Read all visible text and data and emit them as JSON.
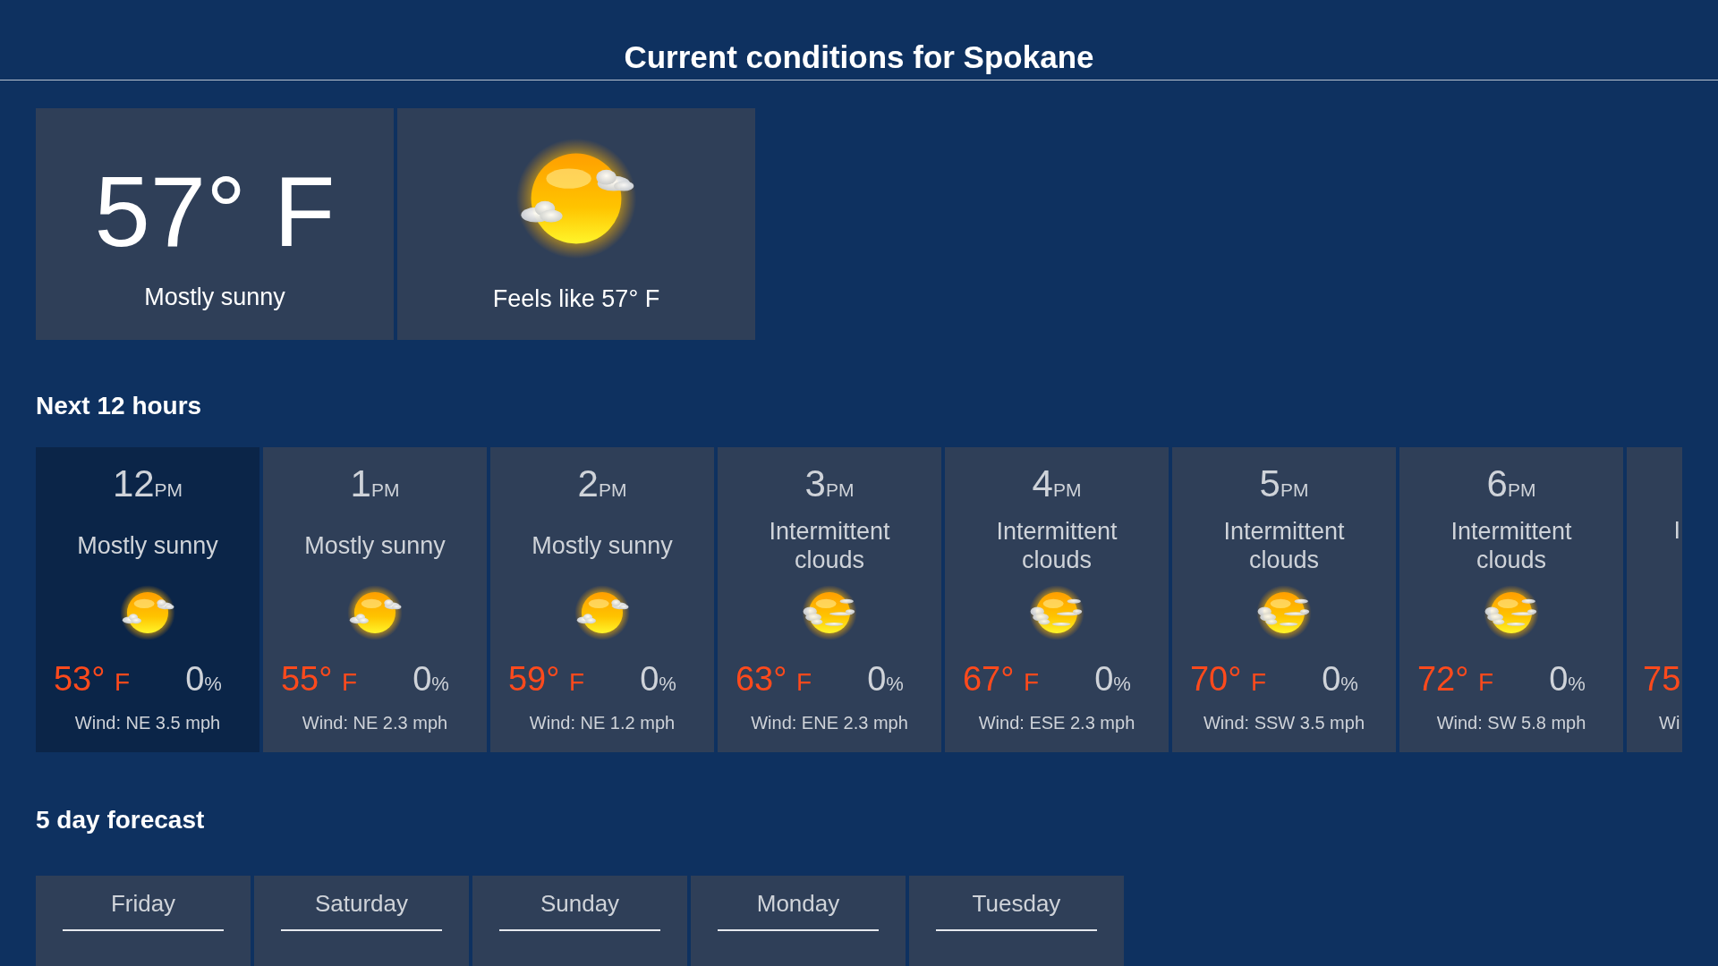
{
  "header": {
    "title": "Current conditions for Spokane"
  },
  "current": {
    "temperature": "57° F",
    "condition": "Mostly sunny",
    "feels_like": "Feels like 57° F"
  },
  "hourly": {
    "heading": "Next 12 hours",
    "hours": [
      {
        "time": "12",
        "period": "PM",
        "condition": "Mostly sunny",
        "kind": "mostly_sunny",
        "temp": "53°",
        "unit": "F",
        "precip": "0",
        "precip_unit": "%",
        "wind": "Wind: NE 3.5 mph",
        "selected": true
      },
      {
        "time": "1",
        "period": "PM",
        "condition": "Mostly sunny",
        "kind": "mostly_sunny",
        "temp": "55°",
        "unit": "F",
        "precip": "0",
        "precip_unit": "%",
        "wind": "Wind: NE 2.3 mph",
        "selected": false
      },
      {
        "time": "2",
        "period": "PM",
        "condition": "Mostly sunny",
        "kind": "mostly_sunny",
        "temp": "59°",
        "unit": "F",
        "precip": "0",
        "precip_unit": "%",
        "wind": "Wind: NE 1.2 mph",
        "selected": false
      },
      {
        "time": "3",
        "period": "PM",
        "condition": "Intermittent clouds",
        "kind": "intermittent_clouds",
        "temp": "63°",
        "unit": "F",
        "precip": "0",
        "precip_unit": "%",
        "wind": "Wind: ENE 2.3 mph",
        "selected": false
      },
      {
        "time": "4",
        "period": "PM",
        "condition": "Intermittent clouds",
        "kind": "intermittent_clouds",
        "temp": "67°",
        "unit": "F",
        "precip": "0",
        "precip_unit": "%",
        "wind": "Wind: ESE 2.3 mph",
        "selected": false
      },
      {
        "time": "5",
        "period": "PM",
        "condition": "Intermittent clouds",
        "kind": "intermittent_clouds",
        "temp": "70°",
        "unit": "F",
        "precip": "0",
        "precip_unit": "%",
        "wind": "Wind: SSW 3.5 mph",
        "selected": false
      },
      {
        "time": "6",
        "period": "PM",
        "condition": "Intermittent clouds",
        "kind": "intermittent_clouds",
        "temp": "72°",
        "unit": "F",
        "precip": "0",
        "precip_unit": "%",
        "wind": "Wind: SW 5.8 mph",
        "selected": false
      }
    ],
    "cut_off_hour": {
      "condition": "I",
      "temp": "75",
      "wind": "Wi"
    }
  },
  "daily": {
    "heading": "5 day forecast",
    "days": [
      {
        "name": "Friday"
      },
      {
        "name": "Saturday"
      },
      {
        "name": "Sunday"
      },
      {
        "name": "Monday"
      },
      {
        "name": "Tuesday"
      }
    ]
  }
}
